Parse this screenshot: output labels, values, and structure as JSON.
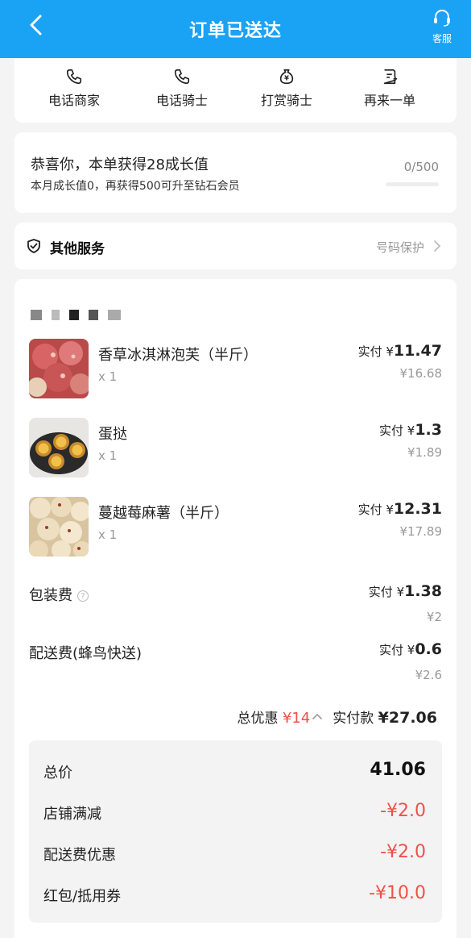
{
  "header": {
    "title": "订单已送达",
    "cs_label": "客服"
  },
  "actions": [
    {
      "label": "电话商家",
      "icon": "phone-icon"
    },
    {
      "label": "电话骑士",
      "icon": "phone-icon"
    },
    {
      "label": "打赏骑士",
      "icon": "money-bag-icon"
    },
    {
      "label": "再来一单",
      "icon": "reorder-icon"
    }
  ],
  "growth": {
    "title": "恭喜你，本单获得28成长值",
    "subtitle": "本月成长值0，再获得500可升至钻石会员",
    "progress_text": "0/500",
    "progress_fraction": 0
  },
  "services": {
    "label": "其他服务",
    "right_text": "号码保护"
  },
  "items": [
    {
      "name": "香草冰淇淋泡芙（半斤）",
      "qty": "x 1",
      "paid_prefix": "实付 ¥",
      "paid": "11.47",
      "original": "¥16.68"
    },
    {
      "name": "蛋挞",
      "qty": "x 1",
      "paid_prefix": "实付 ¥",
      "paid": "1.3",
      "original": "¥1.89"
    },
    {
      "name": "蔓越莓麻薯（半斤）",
      "qty": "x 1",
      "paid_prefix": "实付 ¥",
      "paid": "12.31",
      "original": "¥17.89"
    }
  ],
  "fees": [
    {
      "label": "包装费",
      "paid_prefix": "实付 ¥",
      "paid": "1.38",
      "original": "¥2"
    },
    {
      "label": "配送费(蜂鸟快送)",
      "paid_prefix": "实付 ¥",
      "paid": "0.6",
      "original": "¥2.6"
    }
  ],
  "summary": {
    "discount_label": "总优惠",
    "discount_value": "¥14",
    "paid_label": "实付款",
    "paid_value": "¥27.06"
  },
  "breakdown": [
    {
      "label": "总价",
      "value": "41.06",
      "highlight": false
    },
    {
      "label": "店铺满减",
      "value": "-¥2.0",
      "highlight": true
    },
    {
      "label": "配送费优惠",
      "value": "-¥2.0",
      "highlight": true
    },
    {
      "label": "红包/抵用券",
      "value": "-¥10.0",
      "highlight": true
    }
  ],
  "colors": {
    "header_bg": "#1aa2f5",
    "discount_red": "#f0504a"
  }
}
